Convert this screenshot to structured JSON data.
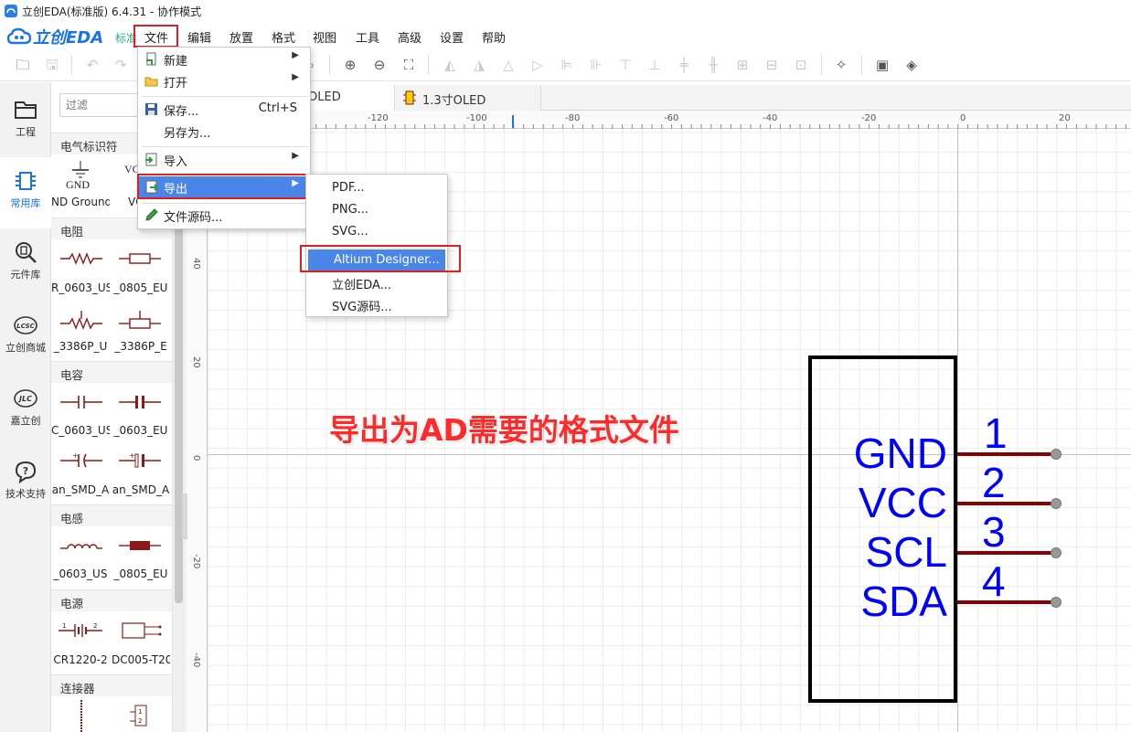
{
  "window": {
    "title": "立创EDA(标准版) 6.4.31 - 协作模式"
  },
  "logo": {
    "text": "立创EDA",
    "sub": "标准"
  },
  "menubar": [
    "文件",
    "编辑",
    "放置",
    "格式",
    "视图",
    "工具",
    "高级",
    "设置",
    "帮助"
  ],
  "leftnav": [
    {
      "label": "工程",
      "icon": "folder-icon"
    },
    {
      "label": "常用库",
      "icon": "chip-icon"
    },
    {
      "label": "元件库",
      "icon": "search-chip-icon"
    },
    {
      "label": "立创商城",
      "icon": "lcsc-icon"
    },
    {
      "label": "嘉立创",
      "icon": "jlc-icon"
    },
    {
      "label": "技术支持",
      "icon": "help-icon"
    }
  ],
  "library": {
    "filter_placeholder": "过滤",
    "sections": {
      "s1": "电气标识符",
      "s2": "电阻",
      "s3": "电容",
      "s4": "电感",
      "s5": "电源",
      "s6": "连接器"
    },
    "items": {
      "gnd_symbol": "GND",
      "gnd": "ND Ground",
      "vcc_symbol": "VC",
      "vcc": "VC",
      "r0603": "R_0603_US",
      "r0805": "_0805_EU",
      "r3386u": "_3386P_U",
      "r3386e": "_3386P_E",
      "c0603u": "C_0603_US",
      "c0603e": "_0603_EU",
      "tan1": "an_SMD_A",
      "tan2": "an_SMD_A",
      "l0603": "_0603_US",
      "l0805": "_0805_EU",
      "cr1220": "CR1220-2",
      "dc005": "DC005-T20"
    }
  },
  "tabs": [
    "OLED",
    "1.3寸OLED"
  ],
  "ruler": {
    "top": [
      "-120",
      "-100",
      "-80",
      "-60",
      "-40",
      "-20",
      "0",
      "20"
    ],
    "left": [
      "40",
      "20",
      "0",
      "-20",
      "-40"
    ]
  },
  "file_menu": {
    "new": "新建",
    "open": "打开",
    "save": "保存...",
    "save_shortcut": "Ctrl+S",
    "save_as": "另存为...",
    "import": "导入",
    "export": "导出",
    "source": "文件源码..."
  },
  "export_menu": {
    "pdf": "PDF...",
    "png": "PNG...",
    "svg": "SVG...",
    "altium": "Altium Designer...",
    "lceda": "立创EDA...",
    "svg_source": "SVG源码..."
  },
  "annotation": "导出为AD需要的格式文件",
  "schematic": {
    "pins": [
      {
        "name": "GND",
        "num": "1"
      },
      {
        "name": "VCC",
        "num": "2"
      },
      {
        "name": "SCL",
        "num": "3"
      },
      {
        "name": "SDA",
        "num": "4"
      }
    ]
  },
  "colors": {
    "accent": "#4a86e8",
    "annotation": "#ff2a2a",
    "pin_text": "#0000ff",
    "pin_line": "#880000",
    "highlight_box": "#e02020"
  }
}
